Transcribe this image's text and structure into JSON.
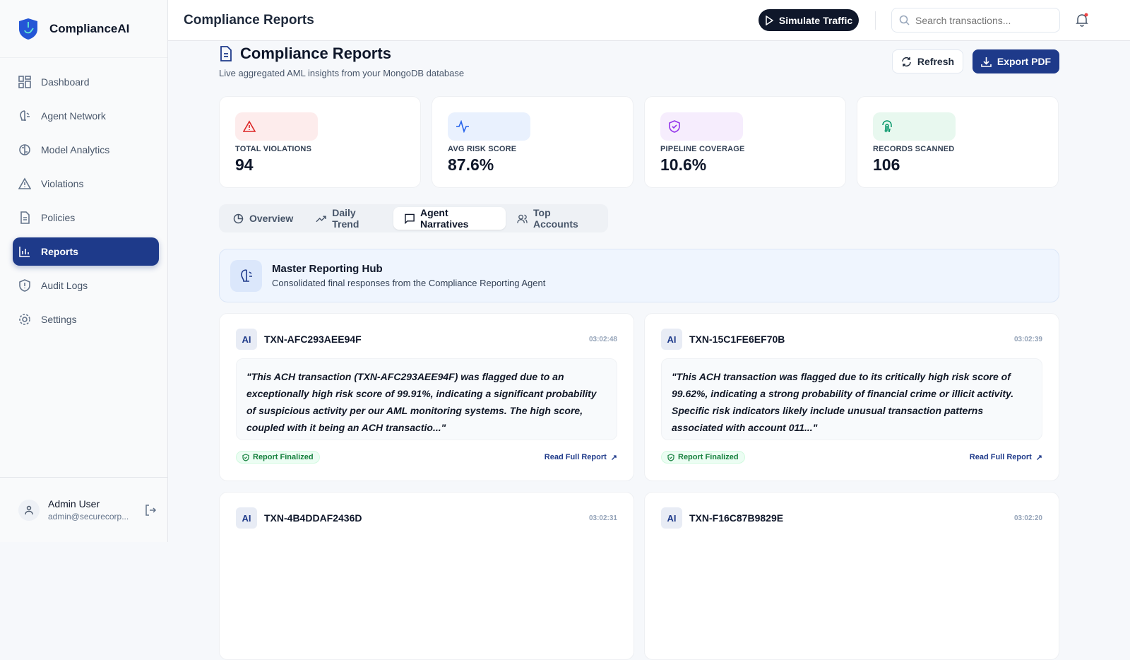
{
  "app": {
    "name": "ComplianceAI"
  },
  "sidebar": {
    "items": [
      {
        "label": "Dashboard",
        "icon": "grid-icon"
      },
      {
        "label": "Agent Network",
        "icon": "brain-icon"
      },
      {
        "label": "Model Analytics",
        "icon": "brain-circuit-icon"
      },
      {
        "label": "Violations",
        "icon": "warning-icon"
      },
      {
        "label": "Policies",
        "icon": "document-icon"
      },
      {
        "label": "Reports",
        "icon": "bar-chart-icon",
        "active": true
      },
      {
        "label": "Audit Logs",
        "icon": "shield-alert-icon"
      },
      {
        "label": "Settings",
        "icon": "gear-icon"
      }
    ],
    "user": {
      "name": "Admin User",
      "email": "admin@securecorp..."
    }
  },
  "header": {
    "title": "Compliance Reports",
    "simulate_label": "Simulate Traffic",
    "search_placeholder": "Search transactions..."
  },
  "page": {
    "title": "Compliance Reports",
    "subtitle": "Live aggregated AML insights from your MongoDB database",
    "refresh_label": "Refresh",
    "export_label": "Export PDF"
  },
  "stats": [
    {
      "label": "TOTAL VIOLATIONS",
      "value": "94",
      "color": "#dc2626",
      "bg": "#fdecec"
    },
    {
      "label": "AVG RISK SCORE",
      "value": "87.6%",
      "color": "#2563eb",
      "bg": "#e9f1fe"
    },
    {
      "label": "PIPELINE COVERAGE",
      "value": "10.6%",
      "color": "#9333ea",
      "bg": "#f6edfd"
    },
    {
      "label": "RECORDS SCANNED",
      "value": "106",
      "color": "#059669",
      "bg": "#e8f8ef"
    }
  ],
  "tabs": [
    {
      "label": "Overview"
    },
    {
      "label": "Daily Trend"
    },
    {
      "label": "Agent Narratives",
      "active": true
    },
    {
      "label": "Top Accounts"
    }
  ],
  "hub": {
    "title": "Master Reporting Hub",
    "subtitle": "Consolidated final responses from the Compliance Reporting Agent"
  },
  "reports": [
    {
      "badge": "AI",
      "id": "TXN-AFC293AEE94F",
      "time": "03:02:48",
      "text": "\"This ACH transaction (TXN-AFC293AEE94F) was flagged due to an exceptionally high risk score of 99.91%, indicating a significant probability of suspicious activity per our AML monitoring systems. The high score, coupled with it being an ACH transactio...\"",
      "status": "Report Finalized",
      "link": "Read Full Report"
    },
    {
      "badge": "AI",
      "id": "TXN-15C1FE6EF70B",
      "time": "03:02:39",
      "text": "\"This ACH transaction was flagged due to its critically high risk score of 99.62%, indicating a strong probability of financial crime or illicit activity. Specific risk indicators likely include unusual transaction patterns associated with account 011...\"",
      "status": "Report Finalized",
      "link": "Read Full Report"
    },
    {
      "badge": "AI",
      "id": "TXN-4B4DDAF2436D",
      "time": "03:02:31"
    },
    {
      "badge": "AI",
      "id": "TXN-F16C87B9829E",
      "time": "03:02:20"
    }
  ]
}
